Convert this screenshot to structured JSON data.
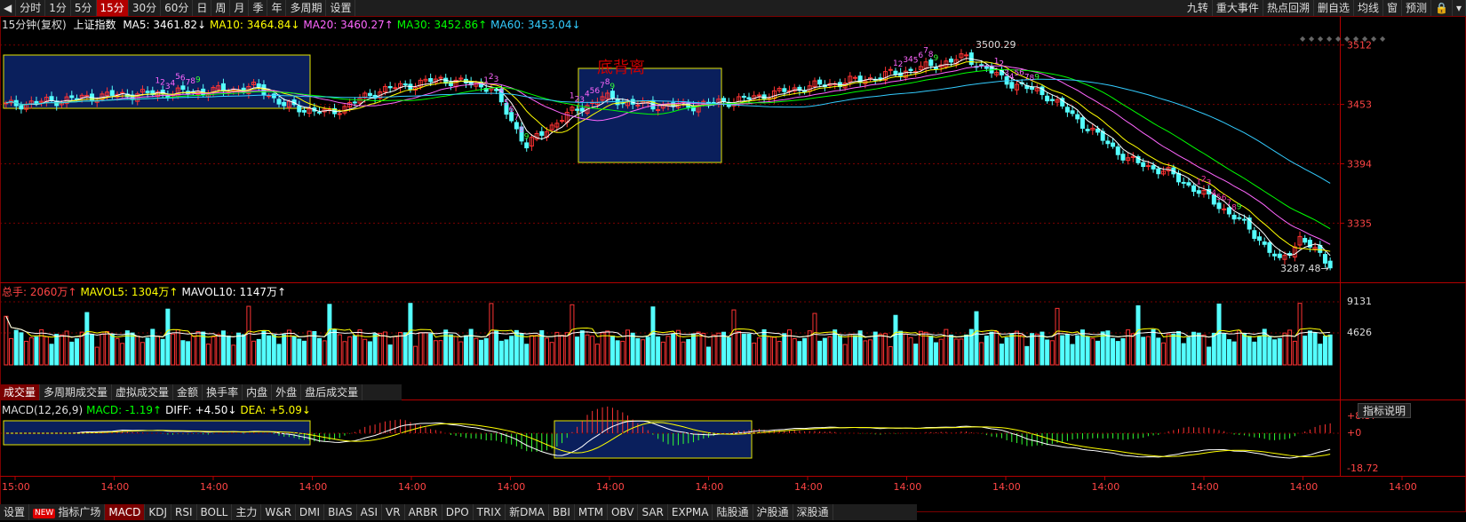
{
  "toolbar": {
    "back_icon": "arrow-left-icon",
    "periods": [
      "分时",
      "1分",
      "5分",
      "15分",
      "30分",
      "60分",
      "日",
      "周",
      "月",
      "季",
      "年",
      "多周期",
      "设置"
    ],
    "active_period": 3,
    "right_buttons": [
      "九转",
      "重大事件",
      "热点回溯",
      "删自选",
      "均线"
    ],
    "right_icons": [
      "window-icon",
      "pin-icon",
      "lock-icon",
      "dropdown-icon"
    ],
    "icon_glyphs": {
      "window-icon": "窗",
      "pin-icon": "预测",
      "lock-icon": "🔒",
      "dropdown-icon": "▾"
    }
  },
  "ma_info": {
    "period_label": "15分钟(复权)",
    "index_name": "上证指数",
    "items": [
      {
        "label": "MA5: 3461.82↓",
        "color": "#ffffff"
      },
      {
        "label": "MA10: 3464.84↓",
        "color": "#ffff00"
      },
      {
        "label": "MA20: 3460.27↑",
        "color": "#ff66ff"
      },
      {
        "label": "MA30: 3452.86↑",
        "color": "#00ff00"
      },
      {
        "label": "MA60: 3453.04↓",
        "color": "#33ccff"
      }
    ]
  },
  "price_axis": {
    "ticks": [
      "3512",
      "3453",
      "3394",
      "3335"
    ],
    "max_label": "3500.29",
    "min_label": "3287.48→"
  },
  "annotation": {
    "text": "底背离",
    "color": "#cc0000"
  },
  "vol_info": {
    "items": [
      {
        "label": "总手: 2060万↑",
        "color": "#ff4444"
      },
      {
        "label": "MAVOL5: 1304万↑",
        "color": "#ffff00"
      },
      {
        "label": "MAVOL10: 1147万↑",
        "color": "#ffffff"
      }
    ],
    "axis": [
      "9131",
      "4626"
    ]
  },
  "vol_tabs": {
    "items": [
      "成交量",
      "多周期成交量",
      "虚拟成交量",
      "金额",
      "换手率",
      "内盘",
      "外盘",
      "盘后成交量"
    ],
    "active": 0
  },
  "macd_info": {
    "items": [
      {
        "label": "MACD(12,26,9)",
        "color": "#dddddd"
      },
      {
        "label": "MACD: -1.19↑",
        "color": "#00ff00"
      },
      {
        "label": "DIFF: +4.50↓",
        "color": "#ffffff"
      },
      {
        "label": "DEA: +5.09↓",
        "color": "#ffff00"
      }
    ],
    "help_label": "指标说明",
    "axis": [
      "+8.37",
      "+0",
      "-18.72"
    ]
  },
  "time_axis": [
    "15:00",
    "14:00",
    "14:00",
    "14:00",
    "14:00",
    "14:00",
    "14:00",
    "14:00",
    "14:00",
    "14:00",
    "14:00",
    "14:00",
    "14:00",
    "14:00",
    "14:00"
  ],
  "bottom_tabs": {
    "settings": "设置",
    "new_badge": "NEW",
    "items": [
      "指标广场",
      "MACD",
      "KDJ",
      "RSI",
      "BOLL",
      "主力",
      "W&R",
      "DMI",
      "BIAS",
      "ASI",
      "VR",
      "ARBR",
      "DPO",
      "TRIX",
      "新DMA",
      "BBI",
      "MTM",
      "OBV",
      "SAR",
      "EXPMA",
      "陆股通",
      "沪股通",
      "深股通"
    ],
    "active": 1
  },
  "colors": {
    "up": "#ff3333",
    "down": "#54ffff",
    "grid": "#7a0000",
    "box_fill": "#0a1f5c",
    "box_border": "#e6e600",
    "ma5": "#ffffff",
    "ma10": "#ffff00",
    "ma20": "#ff66ff",
    "ma30": "#00ff00",
    "ma60": "#33ccff"
  },
  "td_sequence_labels": [
    "1",
    "2",
    "3",
    "4",
    "5",
    "6",
    "7",
    "8",
    "9"
  ]
}
